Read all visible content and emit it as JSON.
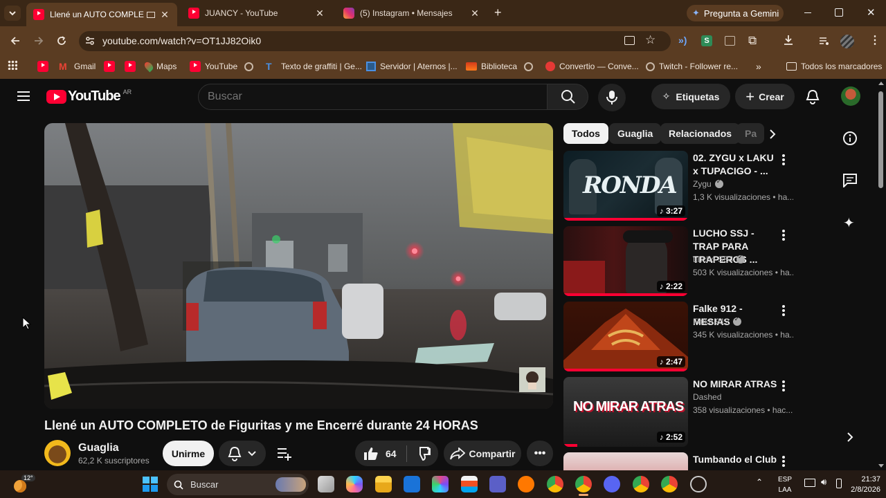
{
  "browser": {
    "tabs": [
      {
        "title": "Llené un AUTO COMPLETO",
        "active": true
      },
      {
        "title": "JUANCY - YouTube",
        "active": false
      },
      {
        "title": "(5) Instagram • Mensajes",
        "active": false
      }
    ],
    "gemini_label": "Pregunta a Gemini",
    "url": "youtube.com/watch?v=OT1JJ82Oik0",
    "bookmarks": [
      {
        "label": "Gmail",
        "icon": "gmail-icon"
      },
      {
        "label": "Maps",
        "icon": "maps-icon"
      },
      {
        "label": "YouTube",
        "icon": "youtube-icon"
      },
      {
        "label": "Texto de graffiti | Ge...",
        "icon": "graffiti-icon"
      },
      {
        "label": "Servidor | Aternos |...",
        "icon": "aternos-icon"
      },
      {
        "label": "Biblioteca",
        "icon": "library-icon"
      },
      {
        "label": "Convertio — Conve...",
        "icon": "convertio-icon"
      },
      {
        "label": "Twitch - Follower re...",
        "icon": "globe-icon"
      }
    ],
    "all_bookmarks": "Todos los marcadores"
  },
  "youtube": {
    "logo_text": "YouTube",
    "region": "AR",
    "search_placeholder": "Buscar",
    "etiquetas_label": "Etiquetas",
    "create_label": "Crear",
    "chips": [
      "Todos",
      "Guaglia",
      "Relacionados",
      "Pa"
    ],
    "video": {
      "title": "Llené un AUTO COMPLETO de Figuritas y me Encerré durante 24 HORAS",
      "channel": "Guaglia",
      "subscribers": "62,2 K suscriptores",
      "join_label": "Unirme",
      "likes": "64",
      "share_label": "Compartir"
    },
    "recommendations": [
      {
        "title": "02. ZYGU x LAKU x TUPACIGO - ...",
        "channel": "Zygu",
        "verified": true,
        "views": "1,3 K visualizaciones • ha...",
        "duration": "3:27",
        "thumb_text": "RONDA"
      },
      {
        "title": "LUCHO SSJ - TRAP PARA TRAPEROS ...",
        "channel": "Lucho SSJ",
        "verified": true,
        "views": "503 K visualizaciones • ha...",
        "duration": "2:22",
        "thumb_text": ""
      },
      {
        "title": "Falke 912 - MESIAS",
        "channel": "Falke 912",
        "verified": true,
        "views": "345 K visualizaciones • ha...",
        "duration": "2:47",
        "thumb_text": ""
      },
      {
        "title": "NO MIRAR ATRAS",
        "channel": "Dashed",
        "verified": false,
        "views": "358 visualizaciones • hac...",
        "duration": "2:52",
        "thumb_text": "NO MIRAR ATRAS"
      },
      {
        "title": "Tumbando el Club",
        "channel": "",
        "verified": false,
        "views": "",
        "duration": "",
        "thumb_text": ""
      }
    ]
  },
  "taskbar": {
    "weather": "12°",
    "search_placeholder": "Buscar",
    "lang_top": "ESP",
    "lang_bottom": "LAA",
    "time": "21:37",
    "date": "2/8/2026"
  },
  "colors": {
    "chrome_dark": "#3a2716",
    "chrome_mid": "#5a3c22",
    "yt_red": "#ff0033",
    "yt_bg": "#0f0f0f"
  }
}
